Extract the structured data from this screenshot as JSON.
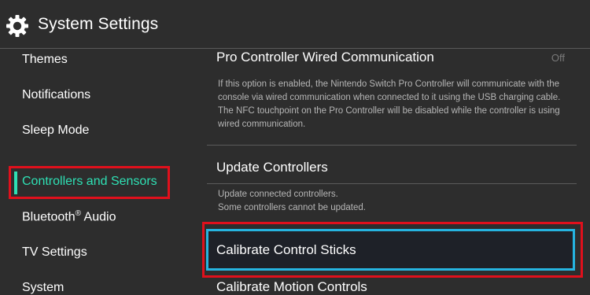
{
  "header": {
    "title": "System Settings",
    "icon": "gear-icon"
  },
  "sidebar": {
    "items": [
      {
        "label": "Themes"
      },
      {
        "label": "Notifications"
      },
      {
        "label": "Sleep Mode"
      },
      {
        "label": "Controllers and Sensors",
        "active": true
      },
      {
        "label": "Bluetooth",
        "sup": "®",
        "suffix": " Audio"
      },
      {
        "label": "TV Settings"
      },
      {
        "label": "System"
      }
    ]
  },
  "content": {
    "pro_wired": {
      "label": "Pro Controller Wired Communication",
      "value": "Off",
      "description": "If this option is enabled, the Nintendo Switch Pro Controller will communicate with the console via wired communication when connected to it using the USB charging cable. The NFC touchpoint on the Pro Controller will be disabled while the controller is using wired communication."
    },
    "update_controllers": {
      "label": "Update Controllers",
      "description_line1": "Update connected controllers.",
      "description_line2": "Some controllers cannot be updated."
    },
    "calibrate_sticks": {
      "label": "Calibrate Control Sticks"
    },
    "calibrate_motion": {
      "label": "Calibrate Motion Controls"
    }
  },
  "colors": {
    "background": "#2d2d2d",
    "accent_active": "#2ee0b4",
    "highlight_red": "#e0101c",
    "focus_blue": "#26b4e0"
  }
}
